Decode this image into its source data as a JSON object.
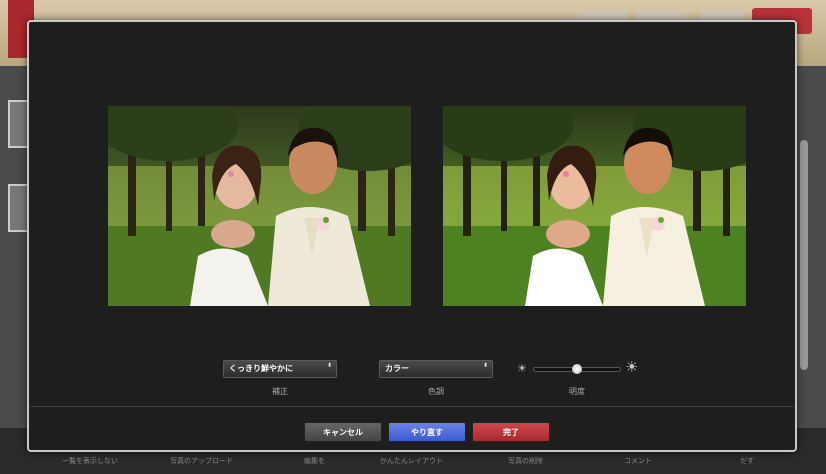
{
  "dialog": {
    "correction": {
      "selected": "くっきり鮮やかに",
      "label": "補正"
    },
    "tone": {
      "selected": "カラー",
      "label": "色調"
    },
    "brightness": {
      "label": "明度",
      "value_fraction": 0.5
    },
    "buttons": {
      "cancel": "キャンセル",
      "redo": "やり直す",
      "done": "完了"
    }
  },
  "background_app": {
    "bottom_toolbar": [
      "一覧を表示しない",
      "写真のアップロード",
      "編集を",
      "かんたんレイアウト",
      "写真の削除",
      "コメント",
      "だす"
    ]
  },
  "colors": {
    "dialog_bg": "#1e1e1e",
    "redo_button": "#4a6ad8",
    "done_button": "#b8353b",
    "cancel_button": "#555555"
  },
  "icons": {
    "select_arrows": "⬍",
    "brightness_low": "☀",
    "brightness_high": "☀"
  }
}
